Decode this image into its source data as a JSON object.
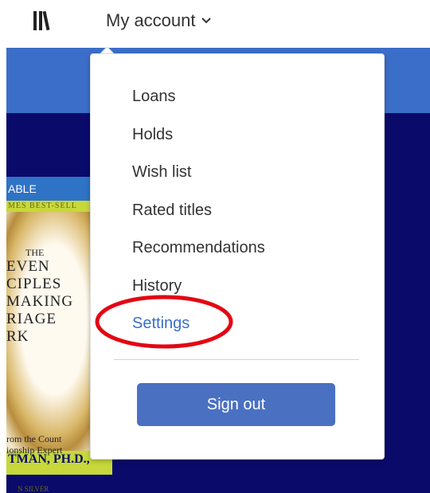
{
  "header": {
    "library_icon": "library-books-icon",
    "account_label": "My account",
    "chevron_icon": "chevron-down-icon"
  },
  "book_cover": {
    "banner_text": "ABLE",
    "subbanner_text": "MES BEST-SELL",
    "title_small": "THE",
    "title_lines": [
      "EVEN",
      "CIPLES",
      "MAKING",
      "RIAGE",
      "RK"
    ],
    "tagline": "rom the Count\nionship Expert",
    "author": "TMAN, PH.D.,",
    "coauthor": "N SILVER"
  },
  "menu": {
    "items": [
      {
        "label": "Loans"
      },
      {
        "label": "Holds"
      },
      {
        "label": "Wish list"
      },
      {
        "label": "Rated titles"
      },
      {
        "label": "Recommendations"
      },
      {
        "label": "History"
      },
      {
        "label": "Settings"
      }
    ],
    "signout_label": "Sign out"
  },
  "colors": {
    "accent": "#3b6ec8",
    "signout_button": "#4a70c2",
    "highlight_ring": "#e30613",
    "page_background": "#0a0a6b"
  }
}
